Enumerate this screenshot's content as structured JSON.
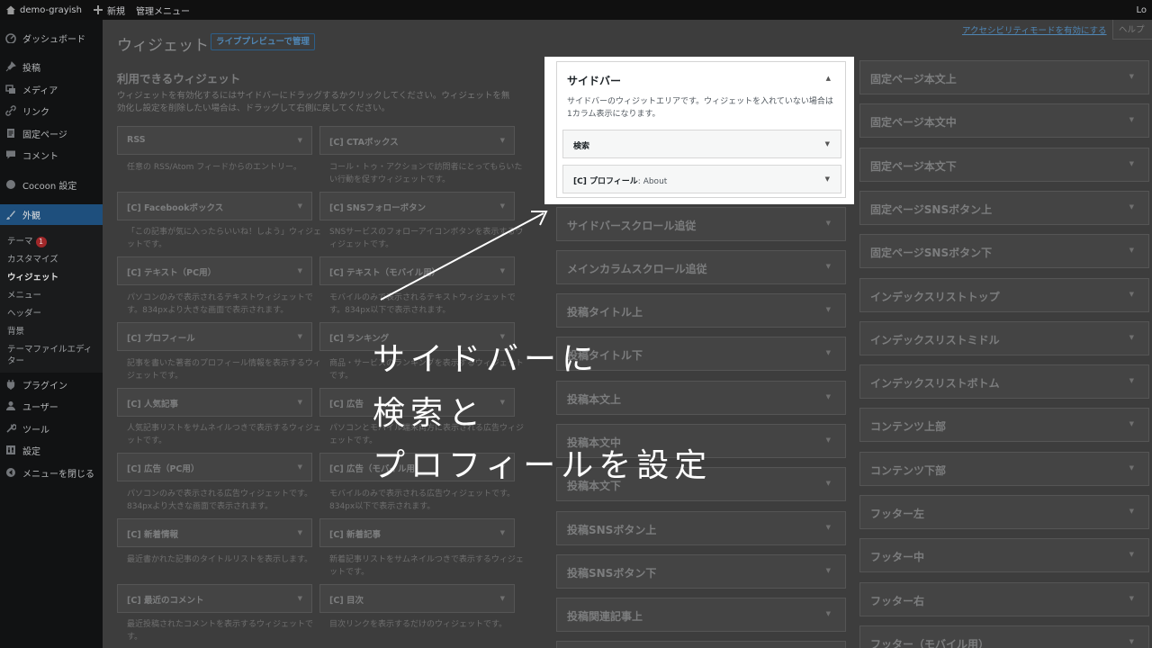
{
  "admin_bar": {
    "site_name": "demo-grayish",
    "new_label": "新規",
    "admin_menu_label": "管理メニュー",
    "right_label": "Lo"
  },
  "sidebar": {
    "items": [
      {
        "label": "ダッシュボード",
        "icon": "dashboard-icon"
      },
      {
        "label": "投稿",
        "icon": "pin-icon"
      },
      {
        "label": "メディア",
        "icon": "media-icon"
      },
      {
        "label": "リンク",
        "icon": "link-icon"
      },
      {
        "label": "固定ページ",
        "icon": "page-icon"
      },
      {
        "label": "コメント",
        "icon": "comment-icon"
      },
      {
        "label": "Cocoon 設定",
        "icon": "cocoon-icon"
      },
      {
        "label": "外観",
        "icon": "appearance-icon"
      },
      {
        "label": "プラグイン",
        "icon": "plugin-icon"
      },
      {
        "label": "ユーザー",
        "icon": "user-icon"
      },
      {
        "label": "ツール",
        "icon": "tool-icon"
      },
      {
        "label": "設定",
        "icon": "settings-icon"
      },
      {
        "label": "メニューを閉じる",
        "icon": "collapse-icon"
      }
    ],
    "submenu": [
      {
        "label": "テーマ",
        "badge": "1"
      },
      {
        "label": "カスタマイズ"
      },
      {
        "label": "ウィジェット"
      },
      {
        "label": "メニュー"
      },
      {
        "label": "ヘッダー"
      },
      {
        "label": "背景"
      },
      {
        "label": "テーマファイルエディ"
      },
      {
        "label": "ター"
      }
    ]
  },
  "header": {
    "title": "ウィジェット",
    "live_preview_label": "ライブプレビューで管理",
    "accessibility_link": "アクセシビリティモードを有効にする",
    "help_label": "ヘルプ"
  },
  "available": {
    "title": "利用できるウィジェット",
    "description": "ウィジェットを有効化するにはサイドバーにドラッグするかクリックしてください。ウィジェットを無効化し設定を削除したい場合は、ドラッグして右側に戻してください。",
    "widgets": [
      {
        "label": "RSS",
        "desc": "任意の RSS/Atom フィードからのエントリー。"
      },
      {
        "label": "[C] CTAボックス",
        "desc": "コール・トゥ・アクションで訪問者にとってもらいたい行動を促すウィジェットです。"
      },
      {
        "label": "[C] Facebookボックス",
        "desc": "「この記事が気に入ったらいいね！しよう」ウィジェットです。"
      },
      {
        "label": "[C] SNSフォローボタン",
        "desc": "SNSサービスのフォローアイコンボタンを表示するウィジェットです。"
      },
      {
        "label": "[C] テキスト（PC用）",
        "desc": "パソコンのみで表示されるテキストウィジェットです。834pxより大きな画面で表示されます。"
      },
      {
        "label": "[C] テキスト（モバイル用）",
        "desc": "モバイルのみで表示されるテキストウィジェットです。834px以下で表示されます。"
      },
      {
        "label": "[C] プロフィール",
        "desc": "記事を書いた著者のプロフィール情報を表示するウィジェットです。"
      },
      {
        "label": "[C] ランキング",
        "desc": "商品・サービスのランキングを表示するウィジェットです。"
      },
      {
        "label": "[C] 人気記事",
        "desc": "人気記事リストをサムネイルつきで表示するウィジェットです。"
      },
      {
        "label": "[C] 広告",
        "desc": "パソコンとモバイル端末両方に表示される広告ウィジェットです。"
      },
      {
        "label": "[C] 広告（PC用）",
        "desc": "パソコンのみで表示される広告ウィジェットです。834pxより大きな画面で表示されます。"
      },
      {
        "label": "[C] 広告（モバイル用）",
        "desc": "モバイルのみで表示される広告ウィジェットです。834px以下で表示されます。"
      },
      {
        "label": "[C] 新着情報",
        "desc": "最近書かれた記事のタイトルリストを表示します。"
      },
      {
        "label": "[C] 新着記事",
        "desc": "新着記事リストをサムネイルつきで表示するウィジェットです。"
      },
      {
        "label": "[C] 最近のコメント",
        "desc": "最近投稿されたコメントを表示するウィジェットです。"
      },
      {
        "label": "[C] 目次",
        "desc": "目次リンクを表示するだけのウィジェットです。"
      }
    ]
  },
  "sidebar_area": {
    "title": "サイドバー",
    "description": "サイドバーのウィジットエリアです。ウィジェットを入れていない場合は1カラム表示になります。",
    "widgets": [
      {
        "label": "検索",
        "sub": ""
      },
      {
        "label": "[C] プロフィール",
        "sub": ": About"
      }
    ]
  },
  "middle_areas": [
    "サイドバースクロール追従",
    "メインカラムスクロール追従",
    "投稿タイトル上",
    "投稿タイトル下",
    "投稿本文上",
    "投稿本文中",
    "投稿本文下",
    "投稿SNSボタン上",
    "投稿SNSボタン下",
    "投稿関連記事上"
  ],
  "right_areas": [
    "固定ページ本文上",
    "固定ページ本文中",
    "固定ページ本文下",
    "固定ページSNSボタン上",
    "固定ページSNSボタン下",
    "インデックスリストトップ",
    "インデックスリストミドル",
    "インデックスリストボトム",
    "コンテンツ上部",
    "コンテンツ下部",
    "フッター左",
    "フッター中",
    "フッター右",
    "フッター（モバイル用）"
  ],
  "caption": {
    "line1": "サイドバーに",
    "line2": "検索と",
    "line3": "プロフィールを設定"
  }
}
